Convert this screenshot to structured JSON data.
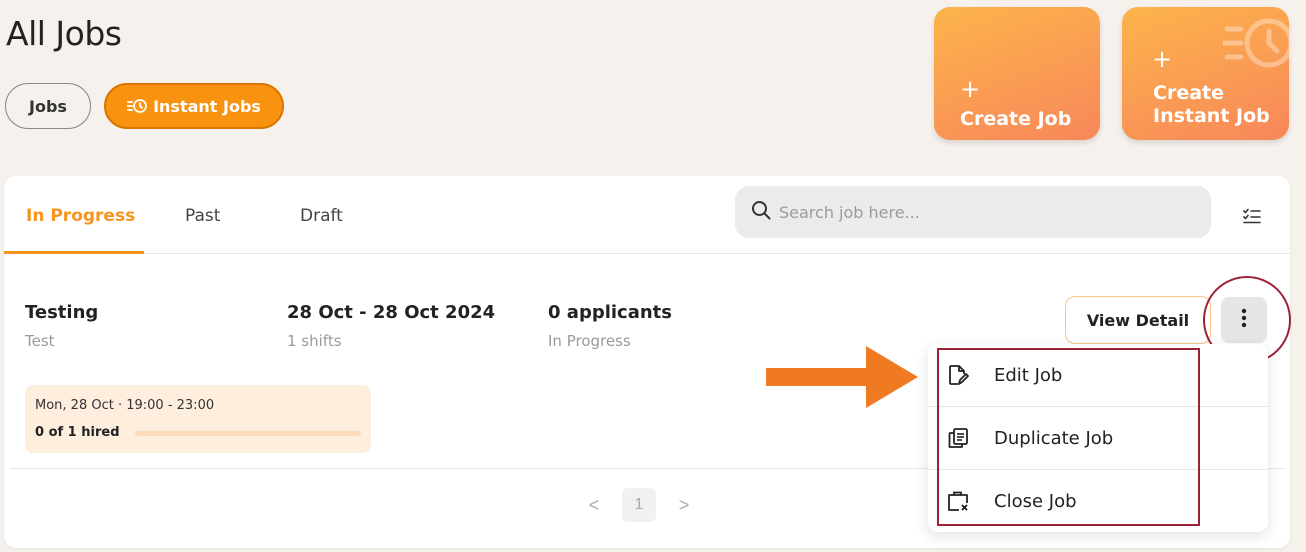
{
  "header": {
    "title": "All Jobs"
  },
  "job_type_tabs": {
    "jobs_label": "Jobs",
    "instant_label": "Instant Jobs"
  },
  "create_cards": {
    "create_job": {
      "plus": "+",
      "label": "Create Job"
    },
    "create_instant": {
      "plus": "+",
      "label_line1": "Create",
      "label_line2": "Instant Job"
    }
  },
  "status_tabs": {
    "items": [
      {
        "label": "In Progress",
        "active": true
      },
      {
        "label": "Past",
        "active": false
      },
      {
        "label": "Draft",
        "active": false
      }
    ]
  },
  "search": {
    "placeholder": "Search job here..."
  },
  "job": {
    "title": "Testing",
    "subtitle": "Test",
    "date_range": "28 Oct - 28 Oct 2024",
    "shifts": "1 shifts",
    "applicants": "0 applicants",
    "status": "In Progress",
    "shift_time": "Mon, 28 Oct · 19:00 - 23:00",
    "hired_text": "0 of 1 hired",
    "hired_fraction": 0,
    "view_detail_label": "View Detail"
  },
  "pagination": {
    "prev": "<",
    "current": "1",
    "next": ">"
  },
  "dropdown_menu": {
    "items": [
      {
        "label": "Edit Job",
        "icon": "edit-document-icon"
      },
      {
        "label": "Duplicate Job",
        "icon": "duplicate-icon"
      },
      {
        "label": "Close Job",
        "icon": "close-briefcase-icon"
      }
    ]
  },
  "colors": {
    "accent": "#f7941d",
    "annotation": "#9b2335",
    "arrow": "#f07a22",
    "background": "#f6f1ec"
  }
}
